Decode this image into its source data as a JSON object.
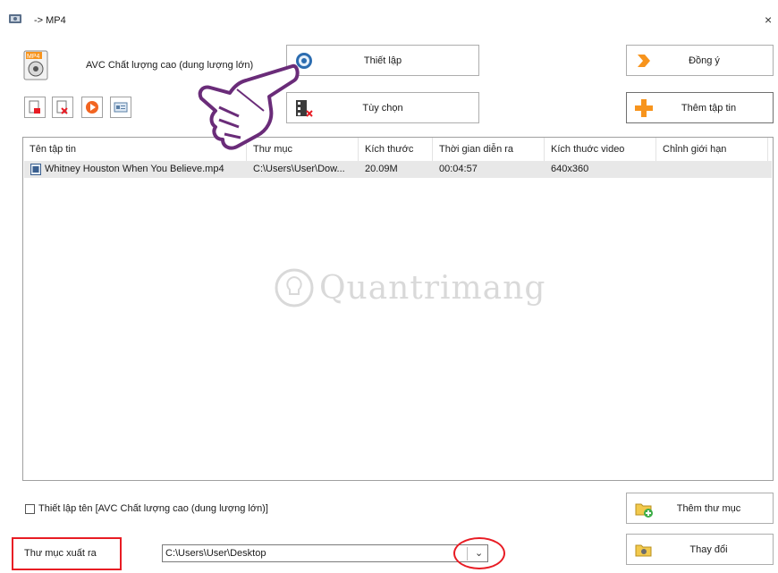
{
  "window": {
    "title": "-> MP4",
    "close": "×"
  },
  "profile": {
    "label": "AVC Chất lượng cao (dung lượng lớn)"
  },
  "buttons": {
    "settings": "Thiết lập",
    "options": "Tùy chọn",
    "ok": "Đồng ý",
    "add_file": "Thêm tập tin",
    "add_folder": "Thêm thư mục",
    "change": "Thay đổi"
  },
  "toolbar": {
    "icons": [
      "remove-file-icon",
      "clear-list-icon",
      "play-icon",
      "media-info-icon"
    ]
  },
  "table": {
    "columns": [
      "Tên tập tin",
      "Thư mục",
      "Kích thước",
      "Thời gian diễn ra",
      "Kích thuớc video",
      "Chỉnh giới hạn"
    ],
    "rows": [
      {
        "name": "Whitney Houston When You Believe.mp4",
        "folder": "C:\\Users\\User\\Dow...",
        "size": "20.09M",
        "duration": "00:04:57",
        "video_size": "640x360",
        "limit": ""
      }
    ]
  },
  "watermark": "Quantrimang",
  "options": {
    "set_name_label": "Thiết lập tên [AVC Chất lượng cao (dung lượng lớn)]",
    "set_name_checked": false
  },
  "output": {
    "label": "Thư mục xuất ra",
    "path": "C:\\Users\\User\\Desktop"
  },
  "colors": {
    "highlight_red": "#e81c24",
    "hand_purple": "#6a2c79",
    "row_selected": "#e8e8e8",
    "accent_orange": "#f7941d"
  }
}
